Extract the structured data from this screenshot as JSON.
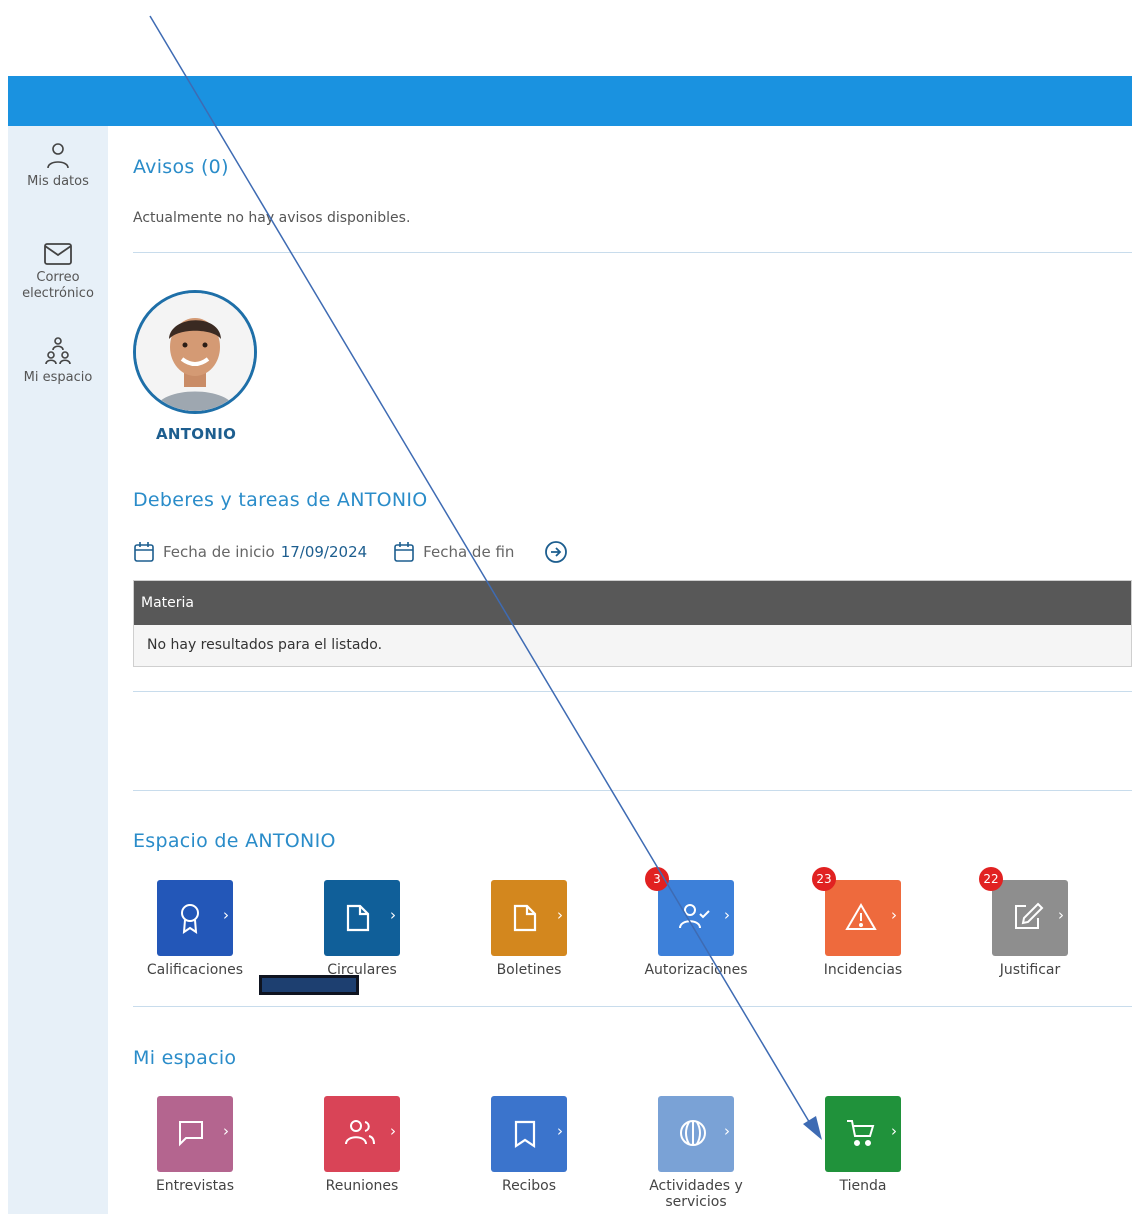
{
  "sidebar": {
    "items": [
      {
        "label": "Mis datos",
        "icon": "user-icon"
      },
      {
        "label": "Correo electrónico",
        "icon": "envelope-icon"
      },
      {
        "label": "Mi espacio",
        "icon": "people-network-icon"
      }
    ]
  },
  "notices": {
    "title": "Avisos (0)",
    "empty_text": "Actualmente no hay avisos disponibles."
  },
  "student": {
    "name": "ANTONIO"
  },
  "homework": {
    "title": "Deberes y tareas de ANTONIO",
    "start_label": "Fecha de inicio",
    "start_value": "17/09/2024",
    "end_label": "Fecha de fin",
    "end_value": "",
    "table_header": "Materia",
    "empty_text": "No hay resultados para el listado."
  },
  "student_space": {
    "title": "Espacio de ANTONIO",
    "tiles": [
      {
        "label": "Calificaciones",
        "color": "#2357b8",
        "icon": "award-icon",
        "badge": ""
      },
      {
        "label": "Circulares",
        "color": "#105f99",
        "icon": "document-icon",
        "badge": ""
      },
      {
        "label": "Boletines",
        "color": "#d3871e",
        "icon": "document-icon",
        "badge": ""
      },
      {
        "label": "Autorizaciones",
        "color": "#3d80d9",
        "icon": "user-check-icon",
        "badge": "3"
      },
      {
        "label": "Incidencias",
        "color": "#ee6a3d",
        "icon": "warning-icon",
        "badge": "23"
      },
      {
        "label": "Justificar",
        "color": "#8e8e8e",
        "icon": "edit-icon",
        "badge": "22"
      }
    ]
  },
  "my_space": {
    "title": "Mi espacio",
    "tiles": [
      {
        "label": "Entrevistas",
        "color": "#b4658f",
        "icon": "chat-icon"
      },
      {
        "label": "Reuniones",
        "color": "#d94457",
        "icon": "group-icon"
      },
      {
        "label": "Recibos",
        "color": "#3b74cc",
        "icon": "receipt-icon"
      },
      {
        "label": "Actividades y servicios",
        "color": "#7aa2d6",
        "icon": "ball-icon"
      },
      {
        "label": "Tienda",
        "color": "#20923b",
        "icon": "cart-icon"
      }
    ]
  },
  "colors": {
    "topbar": "#1a92e0",
    "sidebar": "#e7f0f8",
    "title": "#2a8cc9",
    "annotation_arrow": "#3e6bb3"
  }
}
